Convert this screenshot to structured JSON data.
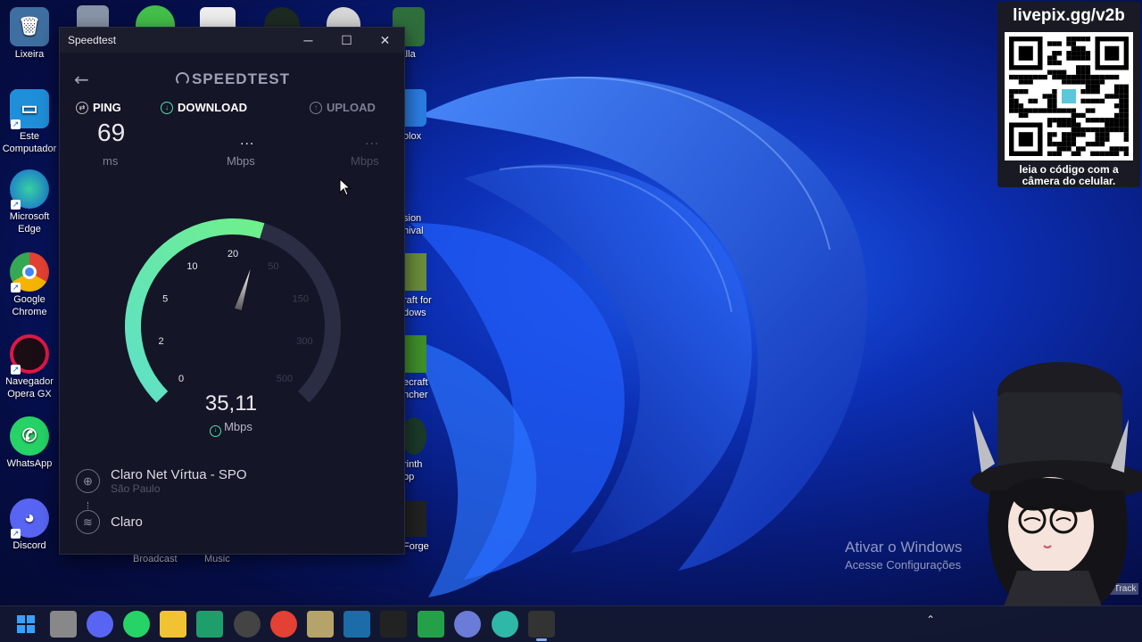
{
  "desktop_icons": [
    {
      "label": "Lixeira",
      "name": "recycle-bin",
      "color": "#7fb2d8"
    },
    {
      "label": "Este Computador",
      "name": "this-pc",
      "color": "#33a3e6"
    },
    {
      "label": "Microsoft Edge",
      "name": "edge",
      "color": "#1aa0d8"
    },
    {
      "label": "Google Chrome",
      "name": "chrome",
      "color": "#e34133"
    },
    {
      "label": "Navegador Opera GX",
      "name": "opera-gx",
      "color": "#e01746"
    },
    {
      "label": "WhatsApp",
      "name": "whatsapp",
      "color": "#25d366"
    },
    {
      "label": "Discord",
      "name": "discord",
      "color": "#5865f2"
    }
  ],
  "desktop_partial_labels": [
    "lhalla",
    "olox",
    "sion",
    "hival",
    "raft for",
    "dows",
    "ecraft",
    "ncher",
    "rinth",
    "pp",
    "Forge"
  ],
  "window": {
    "title": "Speedtest",
    "brand": "SPEEDTEST",
    "ping": {
      "label": "PING",
      "value": "69",
      "unit": "ms"
    },
    "download": {
      "label": "DOWNLOAD",
      "value": "...",
      "unit": "Mbps"
    },
    "upload": {
      "label": "UPLOAD",
      "value": "...",
      "unit": "Mbps"
    },
    "gauge": {
      "current": "35,11",
      "unit": "Mbps",
      "current_value": 35.11,
      "ticks": [
        "0",
        "2",
        "5",
        "10",
        "20",
        "50",
        "150",
        "300",
        "500"
      ],
      "fill_color": "#4fe0b0"
    },
    "server": {
      "name": "Claro Net Vírtua - SPO",
      "location": "São Paulo"
    },
    "connection": {
      "name": "Claro"
    }
  },
  "below_window_labels": [
    "Broadcast",
    "Music"
  ],
  "qr": {
    "title": "livepix.gg/v2b",
    "caption_line1": "leia o código com a",
    "caption_line2": "câmera do celular."
  },
  "watermark": {
    "line1": "Ativar o Windows",
    "line2": "Acesse Configurações"
  },
  "overlay_partial": "pe Track",
  "taskbar_apps": [
    {
      "name": "start",
      "color": "#3aa0ff"
    },
    {
      "name": "file-explorer",
      "color": "#888"
    },
    {
      "name": "discord",
      "color": "#5865f2"
    },
    {
      "name": "whatsapp",
      "color": "#25d366"
    },
    {
      "name": "folder",
      "color": "#f1c232"
    },
    {
      "name": "app-green",
      "color": "#1e9e6a"
    },
    {
      "name": "obs",
      "color": "#444"
    },
    {
      "name": "chrome",
      "color": "#e34133"
    },
    {
      "name": "app-tan",
      "color": "#b6a36a"
    },
    {
      "name": "steam",
      "color": "#1b6ca8"
    },
    {
      "name": "epic-games",
      "color": "#222"
    },
    {
      "name": "xbox",
      "color": "#24a148"
    },
    {
      "name": "settings",
      "color": "#6b7bd8"
    },
    {
      "name": "app-teal",
      "color": "#2fb7a8"
    },
    {
      "name": "speedtest",
      "color": "#333"
    }
  ]
}
